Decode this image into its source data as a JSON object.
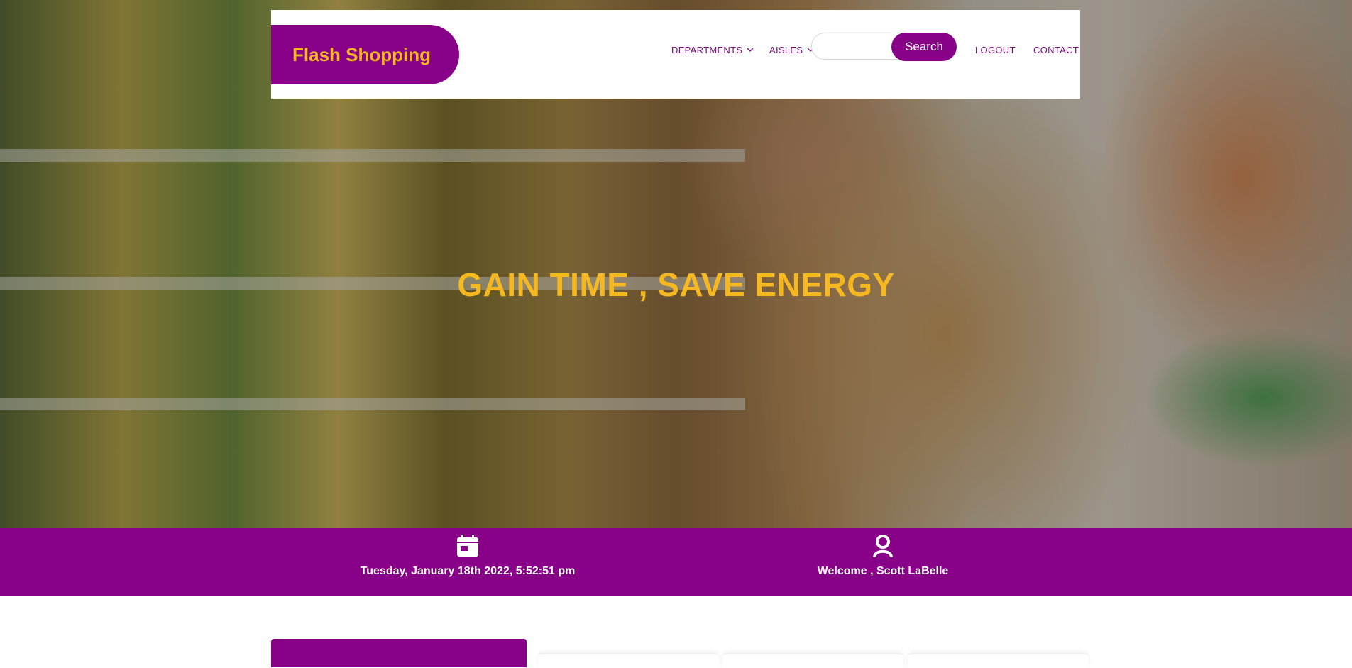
{
  "brand": {
    "name": "Flash Shopping",
    "primary_color": "#870087",
    "accent_color": "#f5b820"
  },
  "nav": {
    "departments": "DEPARTMENTS",
    "aisles": "AISLES",
    "search_placeholder": "",
    "search_button": "Search",
    "logout": "LOGOUT",
    "contact": "CONTACT"
  },
  "hero": {
    "headline": "GAIN TIME , SAVE ENERGY"
  },
  "info_bar": {
    "datetime": "Tuesday, January 18th 2022, 5:52:51 pm",
    "calendar_icon": "calendar-icon",
    "welcome": "Welcome , Scott LaBelle",
    "user_icon": "user-icon"
  }
}
